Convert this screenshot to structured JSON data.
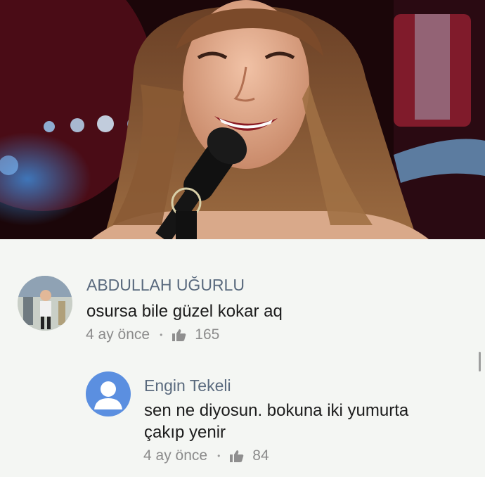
{
  "comments": [
    {
      "author": "ABDULLAH UĞURLU",
      "text_lines": [
        "osursa bile güzel kokar aq"
      ],
      "time": "4 ay önce",
      "likes": "165",
      "avatar_icon": "user-photo-avatar"
    }
  ],
  "replies": [
    {
      "author": "Engin Tekeli",
      "text_lines": [
        "sen ne diyosun. bokuna iki yumurta",
        "çakıp yenir"
      ],
      "time": "4 ay önce",
      "likes": "84",
      "avatar_icon": "default-person-icon"
    }
  ],
  "colors": {
    "author": "#5a6a7e",
    "text": "#1c1c1c",
    "meta": "#8b8b8b",
    "default_avatar_bg": "#5b8fe0",
    "background": "#f4f6f3"
  }
}
